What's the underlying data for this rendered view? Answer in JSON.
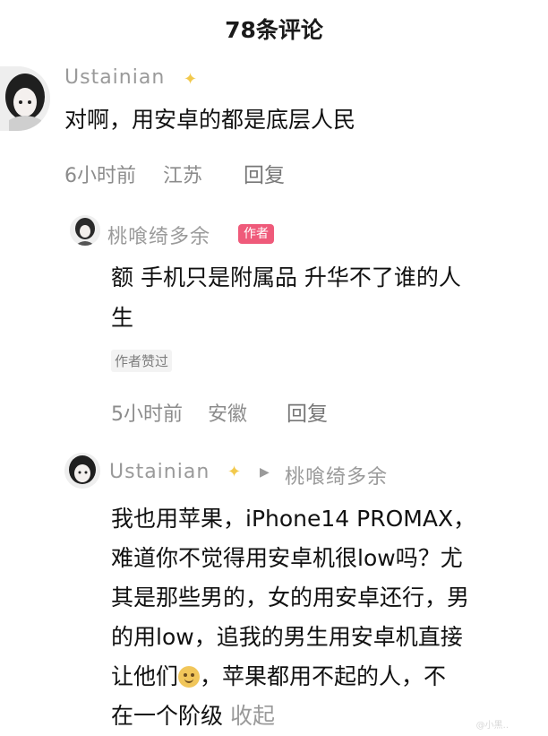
{
  "header": {
    "title": "78条评论"
  },
  "comments": [
    {
      "user": "Ustainian",
      "text": "对啊，用安卓的都是底层人民",
      "time": "6小时前",
      "location": "江苏",
      "reply_label": "回复"
    },
    {
      "user": "桃喰绮多余",
      "author_badge": "作者",
      "text_line1": "额 手机只是附属品 升华不了谁的人",
      "text_line2": "生",
      "author_liked": "作者赞过",
      "time": "5小时前",
      "location": "安徽",
      "reply_label": "回复"
    },
    {
      "user": "Ustainian",
      "reply_to": "桃喰绮多余",
      "lines": [
        "我也用苹果，iPhone14 PROMAX，",
        "难道你不觉得用安卓机很low吗？尤",
        "其是那些男的，女的用安卓还行，男",
        "的用low，追我的男生用安卓机直接"
      ],
      "line5_before": "让他们",
      "line5_after": "，苹果都用不起的人，不",
      "line6": "在一个阶级",
      "collapse_label": "收起"
    }
  ],
  "watermark": "@小黑..",
  "colors": {
    "badge": "#ef5a7a",
    "muted": "#9a9a9a",
    "sparkle": "#f2c94c"
  }
}
